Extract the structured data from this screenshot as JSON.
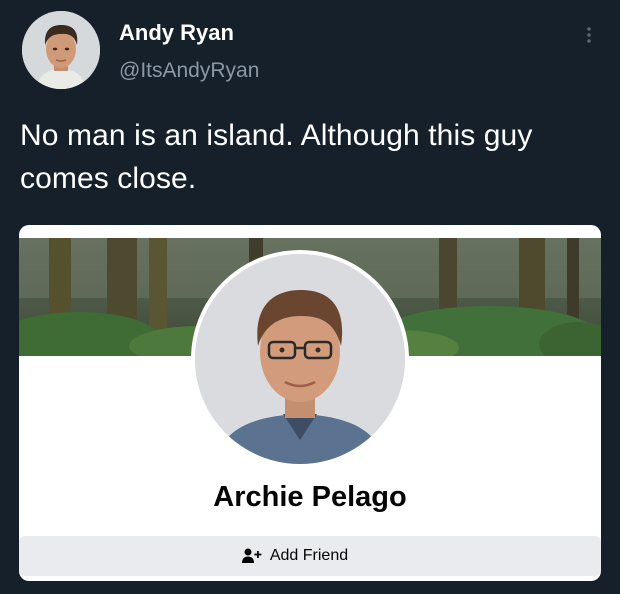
{
  "tweet": {
    "author": {
      "display_name": "Andy Ryan",
      "handle": "@ItsAndyRyan",
      "avatar": "man-portrait"
    },
    "menu_icon": "more-vertical-icon",
    "text": "No man is an island. Although this guy comes close."
  },
  "profile_card": {
    "cover_photo": "forest-photo",
    "profile_picture": "man-with-glasses-portrait",
    "name": "Archie Pelago",
    "add_friend": {
      "icon": "add-friend-icon",
      "label": "Add Friend"
    }
  },
  "colors": {
    "background": "#15202b",
    "primary_text": "#ffffff",
    "secondary_text": "#8b98a5",
    "card_background": "#ffffff",
    "button_background": "#e9ebee"
  }
}
